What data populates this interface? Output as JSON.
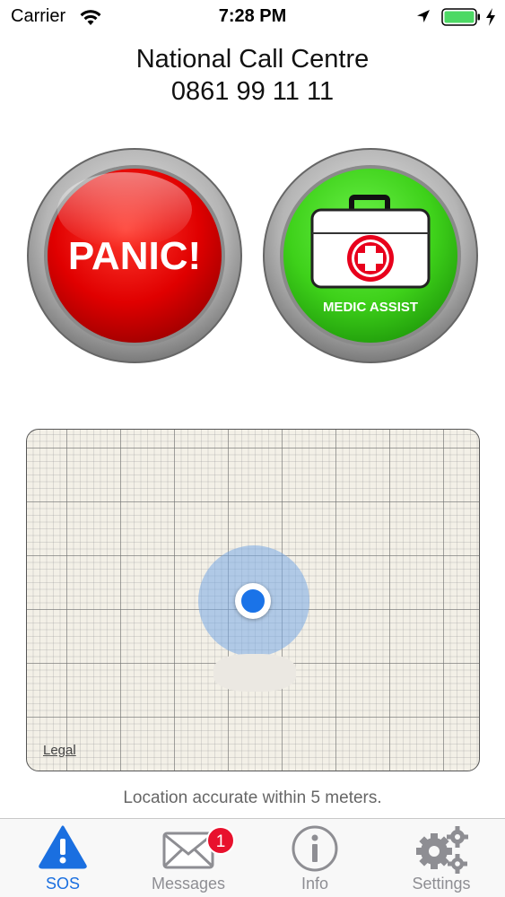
{
  "status_bar": {
    "carrier": "Carrier",
    "time": "7:28 PM",
    "battery_color": "#4cd964"
  },
  "header": {
    "line1": "National Call Centre",
    "line2": "0861 99 11 11"
  },
  "buttons": {
    "panic": {
      "label": "PANIC!",
      "color": "#e00000"
    },
    "medic": {
      "label": "MEDIC ASSIST",
      "color": "#3ed11a",
      "icon": "first-aid-kit-icon"
    }
  },
  "map": {
    "legal": "Legal",
    "accuracy_text": "Location accurate within 5 meters."
  },
  "tab_bar": {
    "active": "sos",
    "tabs": [
      {
        "id": "sos",
        "label": "SOS",
        "icon": "warning-icon"
      },
      {
        "id": "messages",
        "label": "Messages",
        "icon": "envelope-icon",
        "badge": "1"
      },
      {
        "id": "info",
        "label": "Info",
        "icon": "info-icon"
      },
      {
        "id": "settings",
        "label": "Settings",
        "icon": "gears-icon"
      }
    ]
  }
}
